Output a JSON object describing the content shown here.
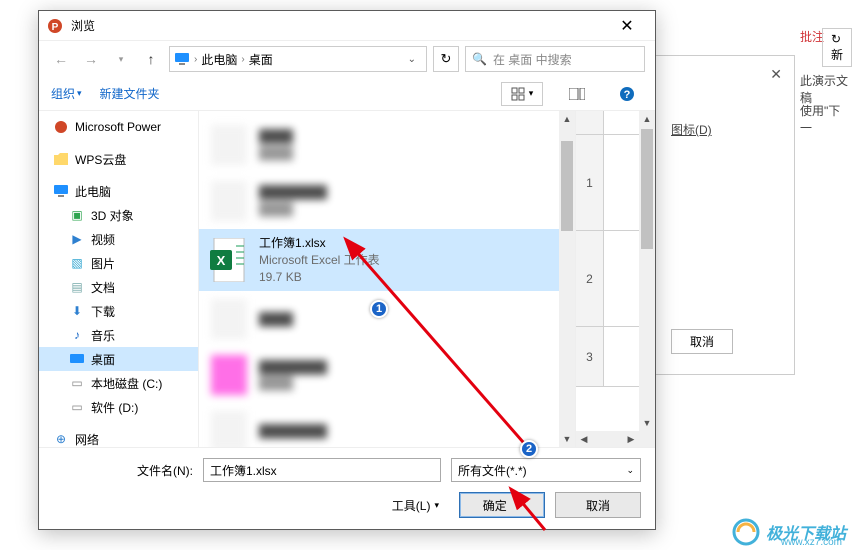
{
  "bg": {
    "heading": "批注",
    "new_btn": "新",
    "line1": "此演示文稿",
    "line2": "使用\"下一",
    "icon_d": "图标(D)",
    "cancel": "取消"
  },
  "dialog": {
    "title": "浏览",
    "breadcrumb": {
      "root": "此电脑",
      "current": "桌面"
    },
    "search_placeholder": "在 桌面 中搜索",
    "toolbar": {
      "organize": "组织",
      "new_folder": "新建文件夹"
    },
    "tree": {
      "ppt": "Microsoft Power",
      "wps": "WPS云盘",
      "this_pc": "此电脑",
      "obj3d": "3D 对象",
      "video": "视频",
      "pictures": "图片",
      "documents": "文档",
      "downloads": "下载",
      "music": "音乐",
      "desktop": "桌面",
      "disk_c": "本地磁盘 (C:)",
      "disk_soft": "软件 (D:)",
      "network": "网络"
    },
    "selected_file": {
      "name": "工作簿1.xlsx",
      "type": "Microsoft Excel 工作表",
      "size": "19.7 KB"
    },
    "preview_rows": [
      "1",
      "2",
      "3"
    ],
    "footer": {
      "filename_label": "文件名(N):",
      "filename_value": "工作簿1.xlsx",
      "filetype": "所有文件(*.*)",
      "tools": "工具(L)",
      "ok": "确定",
      "cancel": "取消"
    }
  },
  "annotations": {
    "badge1": "1",
    "badge2": "2"
  },
  "watermark": {
    "text": "极光下载站",
    "url": "www.xz7.com"
  }
}
